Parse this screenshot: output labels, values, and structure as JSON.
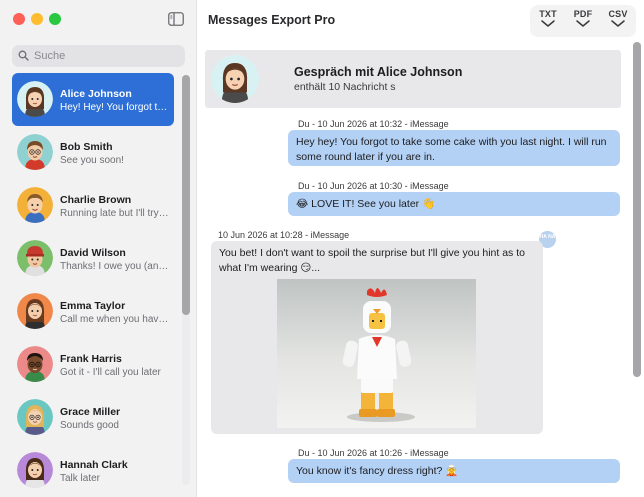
{
  "app": {
    "title": "Messages Export Pro"
  },
  "search": {
    "placeholder": "Suche"
  },
  "export": {
    "txt": "TXT",
    "pdf": "PDF",
    "csv": "CSV"
  },
  "contacts": [
    {
      "name": "Alice Johnson",
      "preview": "Hey! Hey! You forgot to take some cake",
      "active": true
    },
    {
      "name": "Bob Smith",
      "preview": "See you soon!"
    },
    {
      "name": "Charlie Brown",
      "preview": "Running late but I'll try to make it"
    },
    {
      "name": "David Wilson",
      "preview": "Thanks! I owe you (and Sarah)"
    },
    {
      "name": "Emma Taylor",
      "preview": "Call me when you have a moment"
    },
    {
      "name": "Frank Harris",
      "preview": "Got it - I'll call you later"
    },
    {
      "name": "Grace Miller",
      "preview": "Sounds good"
    },
    {
      "name": "Hannah Clark",
      "preview": "Talk later"
    }
  ],
  "conversation": {
    "title": "Gespräch mit Alice Johnson",
    "count": "enthält 10 Nachricht s"
  },
  "messages": [
    {
      "meta": "Du - 10 Jun 2026 at 10:32 - iMessage",
      "text": "Hey hey! You forgot to take some cake with you last night. I will run some round later if you are in.",
      "direction": "out"
    },
    {
      "meta": "Du - 10 Jun 2026 at 10:30 - iMessage",
      "text": "😂 LOVE IT! See you later 👋",
      "direction": "out"
    },
    {
      "meta": "10 Jun 2026 at 10:28 - iMessage",
      "text": "You bet! I don't want to spoil the surprise but I'll give you hint as to what I'm wearing 😏...",
      "direction": "in",
      "badge": "HA NA"
    },
    {
      "meta": "Du - 10 Jun 2026 at 10:26 - iMessage",
      "text": "You know it's fancy dress right? 🧝",
      "direction": "out"
    }
  ],
  "colors": {
    "accent": "#2d6fd6",
    "outgoing": "#b3d0f5",
    "incoming": "#e8e8ea"
  }
}
